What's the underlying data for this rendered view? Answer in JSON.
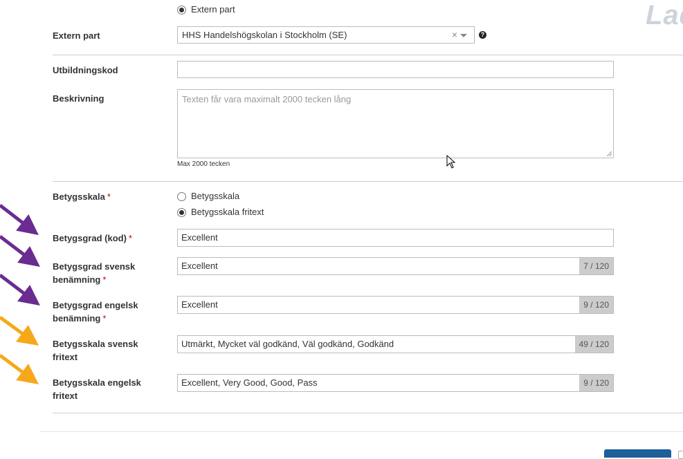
{
  "header": {
    "logo_text": "Lad"
  },
  "extern_part_radio": {
    "label": "Extern part",
    "checked": true
  },
  "extern_part": {
    "label": "Extern part",
    "value": "HHS Handelshögskolan i Stockholm (SE)",
    "clear_symbol": "×",
    "help_symbol": "?"
  },
  "utbildningskod": {
    "label": "Utbildningskod",
    "value": ""
  },
  "beskrivning": {
    "label": "Beskrivning",
    "placeholder": "Texten får vara maximalt 2000 tecken lång",
    "hint": "Max 2000 tecken"
  },
  "betygsskala": {
    "label": "Betygsskala",
    "required_mark": "*",
    "options": [
      {
        "label": "Betygsskala",
        "checked": false
      },
      {
        "label": "Betygsskala fritext",
        "checked": true
      }
    ]
  },
  "fields": [
    {
      "label": "Betygsgrad (kod)",
      "required": "*",
      "value": "Excellent",
      "counter": ""
    },
    {
      "label_line1": "Betygsgrad svensk",
      "label_line2": "benämning",
      "required": "*",
      "value": "Excellent",
      "counter": "7 / 120"
    },
    {
      "label_line1": "Betygsgrad engelsk",
      "label_line2": "benämning",
      "required": "*",
      "value": "Excellent",
      "counter": "9 / 120"
    },
    {
      "label_line1": "Betygsskala svensk",
      "label_line2": "fritext",
      "value": "Utmärkt, Mycket väl godkänd, Väl godkänd, Godkänd",
      "counter": "49 / 120"
    },
    {
      "label_line1": "Betygsskala engelsk",
      "label_line2": "fritext",
      "value": "Excellent, Very Good, Good, Pass",
      "counter": "9 / 120"
    }
  ],
  "annotation_colors": {
    "purple": "#6a2c91",
    "orange": "#f5a91a"
  }
}
